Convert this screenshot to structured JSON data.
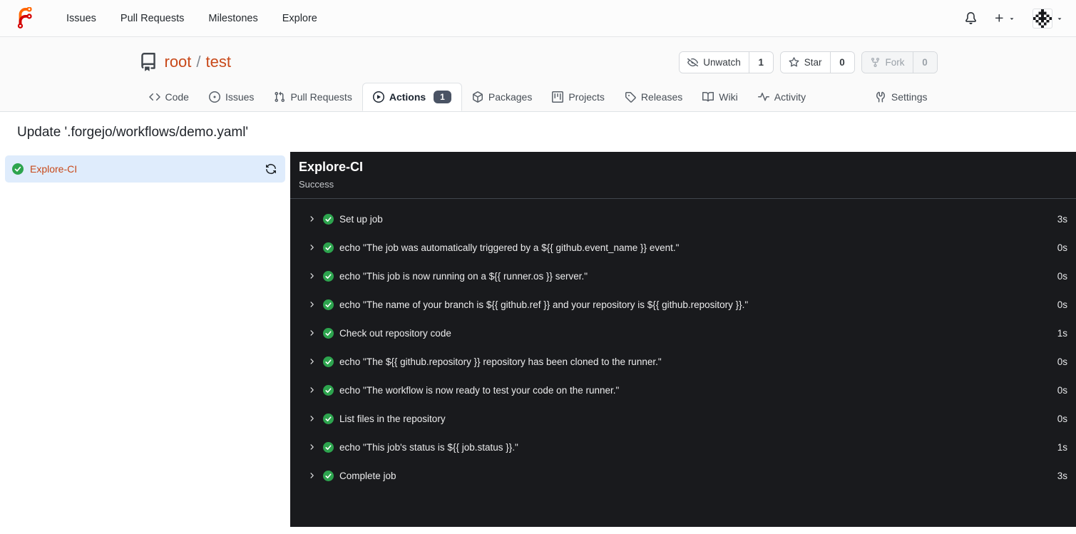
{
  "navbar": {
    "items": [
      {
        "label": "Issues"
      },
      {
        "label": "Pull Requests"
      },
      {
        "label": "Milestones"
      },
      {
        "label": "Explore"
      }
    ],
    "icons": [
      "forgejo-logo",
      "bell-icon",
      "plus-icon",
      "caret-down-icon",
      "avatar-identicon"
    ]
  },
  "repo_header": {
    "owner": "root",
    "separator": "/",
    "name": "test",
    "actions": [
      {
        "label": "Unwatch",
        "count": "1",
        "icon": "eye-closed-icon",
        "disabled": false
      },
      {
        "label": "Star",
        "count": "0",
        "icon": "star-icon",
        "disabled": false
      },
      {
        "label": "Fork",
        "count": "0",
        "icon": "fork-icon",
        "disabled": true
      }
    ],
    "tabs": [
      {
        "label": "Code",
        "icon": "code-icon"
      },
      {
        "label": "Issues",
        "icon": "issue-icon"
      },
      {
        "label": "Pull Requests",
        "icon": "pull-request-icon"
      },
      {
        "label": "Actions",
        "icon": "play-circle-icon",
        "badge": "1",
        "active": true
      },
      {
        "label": "Packages",
        "icon": "package-icon"
      },
      {
        "label": "Projects",
        "icon": "project-icon"
      },
      {
        "label": "Releases",
        "icon": "tag-icon"
      },
      {
        "label": "Wiki",
        "icon": "book-icon"
      },
      {
        "label": "Activity",
        "icon": "pulse-icon"
      },
      {
        "label": "Settings",
        "icon": "tools-icon"
      }
    ]
  },
  "run": {
    "title": "Update '.forgejo/workflows/demo.yaml'",
    "jobs": [
      {
        "name": "Explore-CI",
        "status": "success"
      }
    ],
    "panel": {
      "title": "Explore-CI",
      "status": "Success",
      "steps": [
        {
          "name": "Set up job",
          "duration": "3s"
        },
        {
          "name": "echo \"The job was automatically triggered by a ${{ github.event_name }} event.\"",
          "duration": "0s"
        },
        {
          "name": "echo \"This job is now running on a ${{ runner.os }} server.\"",
          "duration": "0s"
        },
        {
          "name": "echo \"The name of your branch is ${{ github.ref }} and your repository is ${{ github.repository }}.\"",
          "duration": "0s"
        },
        {
          "name": "Check out repository code",
          "duration": "1s"
        },
        {
          "name": "echo \"The ${{ github.repository }} repository has been cloned to the runner.\"",
          "duration": "0s"
        },
        {
          "name": "echo \"The workflow is now ready to test your code on the runner.\"",
          "duration": "0s"
        },
        {
          "name": "List files in the repository",
          "duration": "0s"
        },
        {
          "name": "echo \"This job's status is ${{ job.status }}.\"",
          "duration": "1s"
        },
        {
          "name": "Complete job",
          "duration": "3s"
        }
      ]
    }
  },
  "colors": {
    "brand_orange": "#ff6600",
    "brand_red": "#d40000",
    "link": "#c8491a",
    "success_green": "#2da44e",
    "selected_job_bg": "#dfecfc",
    "console_bg": "#191a1d",
    "badge_bg": "#4a5364"
  }
}
